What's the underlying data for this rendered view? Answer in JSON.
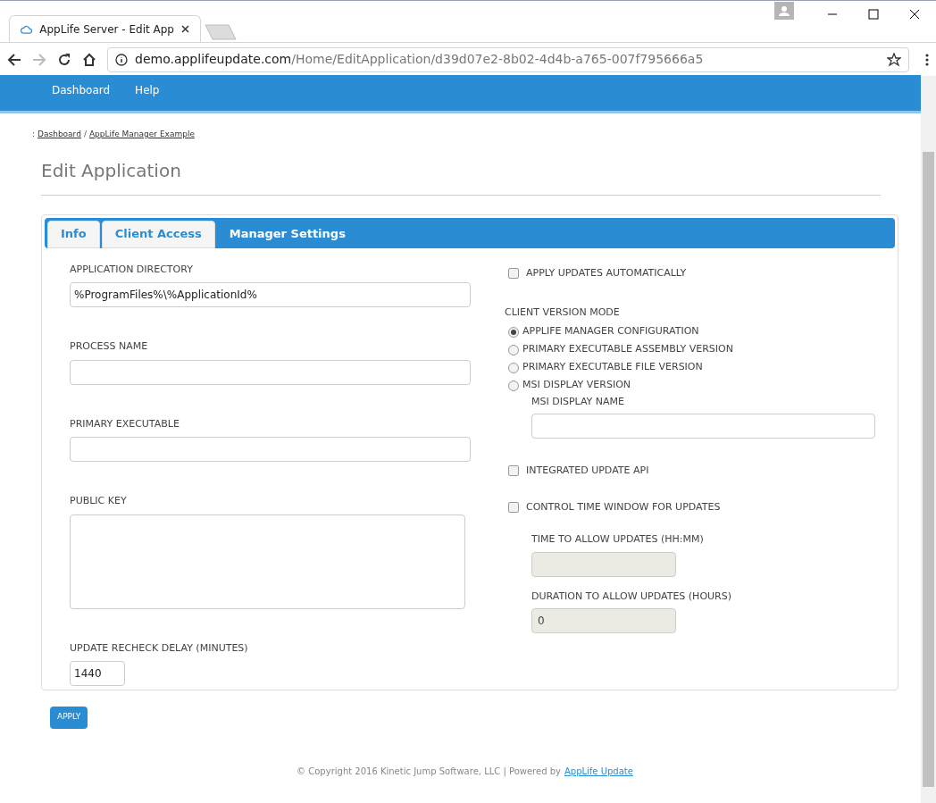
{
  "browser": {
    "tab_title": "AppLife Server - Edit App",
    "url_host": "demo.applifeupdate.com",
    "url_path": "/Home/EditApplication/d39d07e2-8b02-4d4b-a765-007f795666a5"
  },
  "nav": [
    "Dashboard",
    "Help"
  ],
  "breadcrumb": {
    "prefix": ":",
    "items": [
      "Dashboard",
      "AppLife Manager Example"
    ],
    "separator": "/"
  },
  "title": "Edit Application",
  "tabs": [
    {
      "label": "Info",
      "selected": false
    },
    {
      "label": "Client Access",
      "selected": false
    },
    {
      "label": "Manager Settings",
      "selected": true
    }
  ],
  "left_fields": [
    {
      "kind": "text",
      "label": "APPLICATION DIRECTORY",
      "value": "%ProgramFiles%\\%ApplicationId%"
    },
    {
      "kind": "text",
      "label": "PROCESS NAME"
    },
    {
      "kind": "text",
      "label": "PRIMARY EXECUTABLE"
    },
    {
      "kind": "textarea",
      "label": "PUBLIC KEY"
    },
    {
      "kind": "short",
      "label": "UPDATE RECHECK DELAY (MINUTES)",
      "value": "1440"
    }
  ],
  "right_items": [
    {
      "kind": "checkbox",
      "label": "APPLY UPDATES AUTOMATICALLY",
      "checked": false
    },
    {
      "kind": "heading",
      "label": "CLIENT VERSION MODE"
    },
    {
      "kind": "radio",
      "label": "APPLIFE MANAGER CONFIGURATION",
      "selected": true
    },
    {
      "kind": "radio",
      "label": "PRIMARY EXECUTABLE ASSEMBLY VERSION",
      "selected": false
    },
    {
      "kind": "radio",
      "label": "PRIMARY EXECUTABLE FILE VERSION",
      "selected": false
    },
    {
      "kind": "radio",
      "label": "MSI DISPLAY VERSION",
      "selected": false
    },
    {
      "kind": "field",
      "label": "MSI DISPLAY NAME",
      "disabled": false
    },
    {
      "kind": "checkbox",
      "label": "INTEGRATED UPDATE API",
      "checked": false
    },
    {
      "kind": "checkbox",
      "label": "CONTROL TIME WINDOW FOR UPDATES",
      "checked": false
    },
    {
      "kind": "field",
      "label": "TIME TO ALLOW UPDATES (HH:MM)",
      "disabled": true
    },
    {
      "kind": "field",
      "label": "DURATION TO ALLOW UPDATES (HOURS)",
      "disabled": true,
      "value": "0"
    }
  ],
  "apply_button": "APPLY",
  "footer": {
    "text": "© Copyright 2016 Kinetic Jump Software, LLC | Powered by",
    "link": "AppLife Update"
  }
}
